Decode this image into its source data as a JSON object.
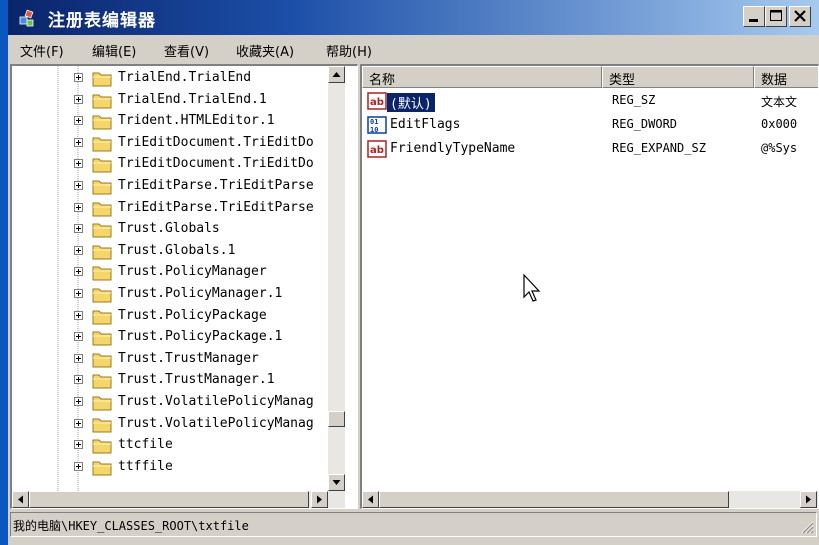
{
  "window": {
    "title": "注册表编辑器"
  },
  "menu": [
    {
      "label": "文件(F)"
    },
    {
      "label": "编辑(E)"
    },
    {
      "label": "查看(V)"
    },
    {
      "label": "收藏夹(A)"
    },
    {
      "label": "帮助(H)"
    }
  ],
  "tree": {
    "items": [
      {
        "label": "TrialEnd.TrialEnd"
      },
      {
        "label": "TrialEnd.TrialEnd.1"
      },
      {
        "label": "Trident.HTMLEditor.1"
      },
      {
        "label": "TriEditDocument.TriEditDo"
      },
      {
        "label": "TriEditDocument.TriEditDo"
      },
      {
        "label": "TriEditParse.TriEditParse"
      },
      {
        "label": "TriEditParse.TriEditParse"
      },
      {
        "label": "Trust.Globals"
      },
      {
        "label": "Trust.Globals.1"
      },
      {
        "label": "Trust.PolicyManager"
      },
      {
        "label": "Trust.PolicyManager.1"
      },
      {
        "label": "Trust.PolicyPackage"
      },
      {
        "label": "Trust.PolicyPackage.1"
      },
      {
        "label": "Trust.TrustManager"
      },
      {
        "label": "Trust.TrustManager.1"
      },
      {
        "label": "Trust.VolatilePolicyManag"
      },
      {
        "label": "Trust.VolatilePolicyManag"
      },
      {
        "label": "ttcfile"
      },
      {
        "label": "ttffile"
      }
    ]
  },
  "list": {
    "columns": [
      {
        "label": "名称"
      },
      {
        "label": "类型"
      },
      {
        "label": "数据"
      }
    ],
    "rows": [
      {
        "name": "(默认)",
        "type": "REG_SZ",
        "data": "文本文",
        "icon": "string-value-icon",
        "selected": true
      },
      {
        "name": "EditFlags",
        "type": "REG_DWORD",
        "data": "0x000",
        "icon": "binary-value-icon",
        "selected": false
      },
      {
        "name": "FriendlyTypeName",
        "type": "REG_EXPAND_SZ",
        "data": "@%Sys",
        "icon": "string-value-icon",
        "selected": false
      }
    ]
  },
  "status": {
    "path": "我的电脑\\HKEY_CLASSES_ROOT\\txtfile"
  },
  "colors": {
    "titlebar_start": "#0a246a",
    "titlebar_end": "#a6caf0",
    "face": "#d4d0c8",
    "selection": "#0a246a",
    "folder": "#f5d66b"
  }
}
